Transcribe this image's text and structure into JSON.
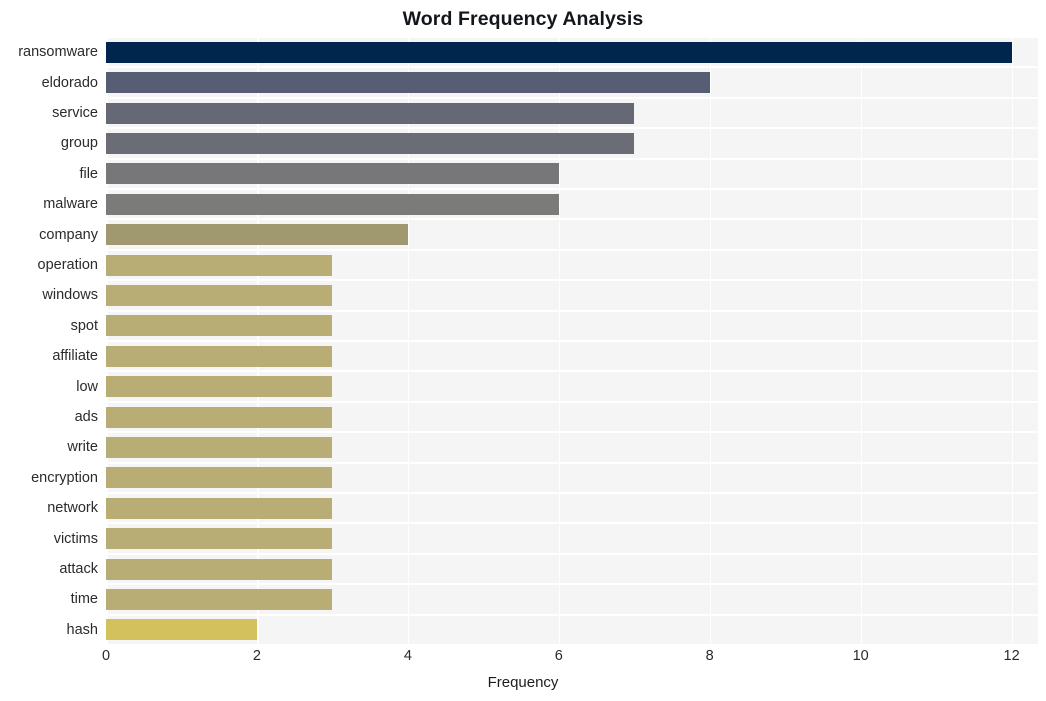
{
  "chart_data": {
    "type": "bar",
    "orientation": "horizontal",
    "title": "Word Frequency Analysis",
    "xlabel": "Frequency",
    "ylabel": "",
    "categories": [
      "ransomware",
      "eldorado",
      "service",
      "group",
      "file",
      "malware",
      "company",
      "operation",
      "windows",
      "spot",
      "affiliate",
      "low",
      "ads",
      "write",
      "encryption",
      "network",
      "victims",
      "attack",
      "time",
      "hash"
    ],
    "values": [
      12,
      8,
      7,
      7,
      6,
      6,
      4,
      3,
      3,
      3,
      3,
      3,
      3,
      3,
      3,
      3,
      3,
      3,
      3,
      2
    ],
    "bar_colors": [
      "#00264d",
      "#575d72",
      "#666875",
      "#6a6c76",
      "#77777a",
      "#7b7b79",
      "#a0996f",
      "#b8ad74",
      "#b8ad74",
      "#b8ad74",
      "#b8ad74",
      "#b8ad74",
      "#b8ad74",
      "#b8ad74",
      "#b8ad74",
      "#b8ad74",
      "#b8ad74",
      "#b8ad74",
      "#b8ad74",
      "#d2c15c"
    ],
    "xticks": [
      0,
      2,
      4,
      6,
      8,
      10,
      12
    ],
    "xtick_labels": [
      "0",
      "2",
      "4",
      "6",
      "8",
      "10",
      "12"
    ],
    "xlim": [
      0,
      12.35
    ],
    "grid": true,
    "grid_axis": "x",
    "grid_color": "#ffffff",
    "plot_background": "#f5f5f6",
    "figure_background": "#ffffff",
    "legend": null
  }
}
